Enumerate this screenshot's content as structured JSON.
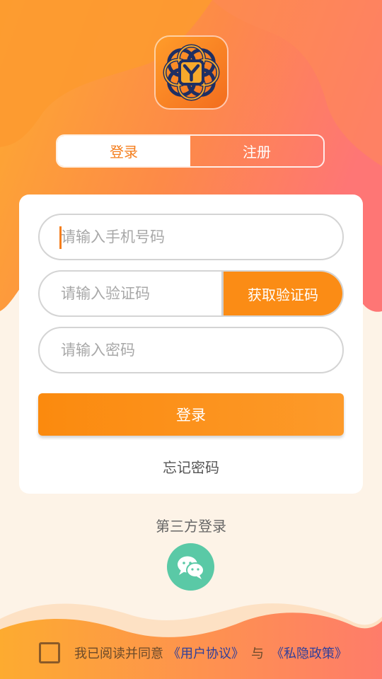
{
  "colors": {
    "accent": "#f47e1d",
    "button": "#fb8c15",
    "wechat": "#5ac9a6",
    "link": "#2f3f9a"
  },
  "logo": {
    "icon": "flower-y-logo-icon"
  },
  "tabs": {
    "login": "登录",
    "register": "注册",
    "active": "login"
  },
  "form": {
    "phone_placeholder": "请输入手机号码",
    "phone_value": "",
    "code_placeholder": "请输入验证码",
    "code_value": "",
    "get_code_label": "获取验证码",
    "password_placeholder": "请输入密码",
    "password_value": "",
    "login_label": "登录",
    "forgot_label": "忘记密码"
  },
  "third_party": {
    "title": "第三方登录",
    "icon": "wechat-icon"
  },
  "agreement": {
    "checked": false,
    "prefix": "我已阅读并同意",
    "user_agreement": "《用户协议》",
    "and": "与",
    "privacy_policy": "《私隐政策》"
  }
}
